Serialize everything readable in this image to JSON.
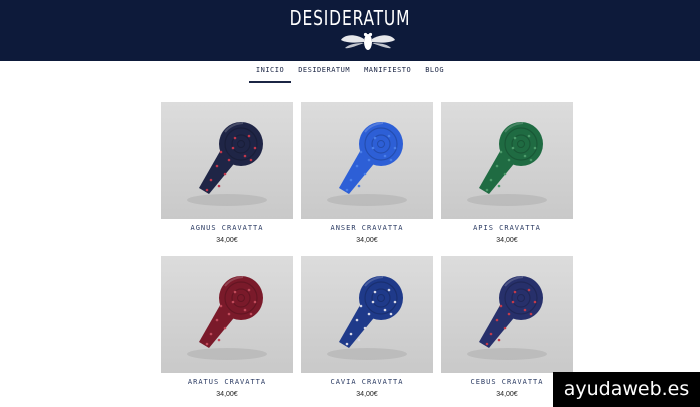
{
  "brand": {
    "title": "DESIDERATUM",
    "logo_icon": "cicada-icon"
  },
  "nav": {
    "items": [
      {
        "label": "INICIO",
        "active": true
      },
      {
        "label": "DESIDERATUM",
        "active": false
      },
      {
        "label": "MANIFIESTO",
        "active": false
      },
      {
        "label": "BLOG",
        "active": false
      }
    ]
  },
  "products": [
    {
      "name": "AGNUS CRAVATTA",
      "price": "34,00€",
      "tie_color": "#1f2546",
      "dot_color": "#c2364a"
    },
    {
      "name": "ANSER CRAVATTA",
      "price": "34,00€",
      "tie_color": "#2d5fd6",
      "dot_color": "#4b7fe8"
    },
    {
      "name": "APIS CRAVATTA",
      "price": "34,00€",
      "tie_color": "#1f6b42",
      "dot_color": "#4c9a6a"
    },
    {
      "name": "ARATUS CRAVATTA",
      "price": "34,00€",
      "tie_color": "#7a1a2a",
      "dot_color": "#c04a5a"
    },
    {
      "name": "CAVIA CRAVATTA",
      "price": "34,00€",
      "tie_color": "#1f3a8a",
      "dot_color": "#d9d9e6"
    },
    {
      "name": "CEBUS CRAVATTA",
      "price": "34,00€",
      "tie_color": "#27306b",
      "dot_color": "#c23a4a"
    }
  ],
  "watermark": "ayudaweb.es"
}
